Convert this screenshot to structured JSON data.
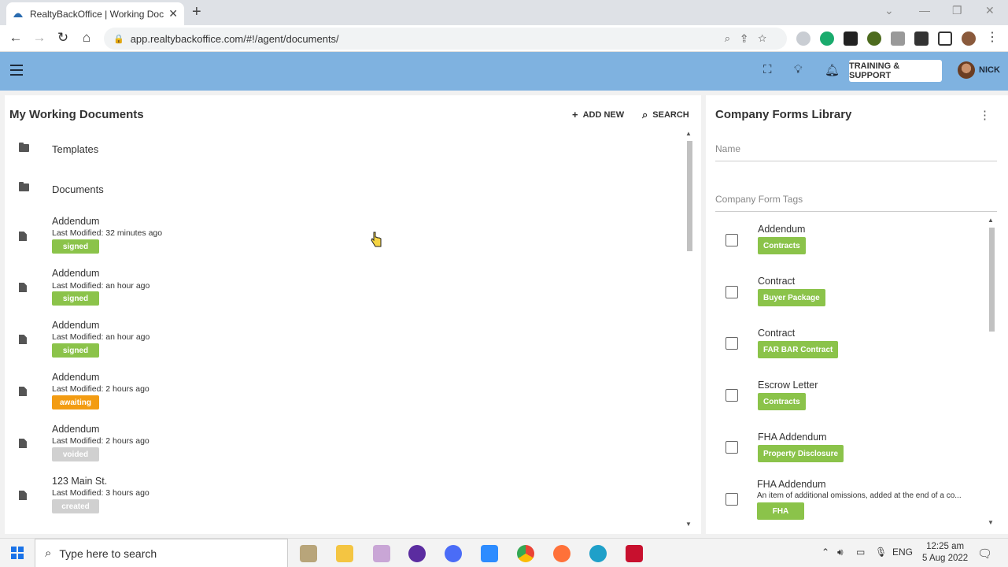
{
  "browser": {
    "tab_title": "RealtyBackOffice | Working Docu",
    "url": "app.realtybackoffice.com/#!/agent/documents/"
  },
  "appbar": {
    "support_label": "TRAINING & SUPPORT",
    "user_name": "NICK"
  },
  "left_panel": {
    "title": "My Working Documents",
    "add_new_label": "ADD NEW",
    "search_label": "SEARCH",
    "folders": [
      {
        "label": "Templates"
      },
      {
        "label": "Documents"
      }
    ],
    "documents": [
      {
        "name": "Addendum",
        "modified": "Last Modified: 32 minutes ago",
        "status": "signed",
        "status_color": "#8bc34a"
      },
      {
        "name": "Addendum",
        "modified": "Last Modified: an hour ago",
        "status": "signed",
        "status_color": "#8bc34a"
      },
      {
        "name": "Addendum",
        "modified": "Last Modified: an hour ago",
        "status": "signed",
        "status_color": "#8bc34a"
      },
      {
        "name": "Addendum",
        "modified": "Last Modified: 2 hours ago",
        "status": "awaiting",
        "status_color": "#f39c12"
      },
      {
        "name": "Addendum",
        "modified": "Last Modified: 2 hours ago",
        "status": "voided",
        "status_color": "#d0d0d0"
      },
      {
        "name": "123 Main St.",
        "modified": "Last Modified: 3 hours ago",
        "status": "created",
        "status_color": "#d0d0d0"
      }
    ]
  },
  "right_panel": {
    "title": "Company Forms Library",
    "name_placeholder": "Name",
    "tags_placeholder": "Company Form Tags",
    "forms": [
      {
        "name": "Addendum",
        "description": "",
        "tag": "Contracts"
      },
      {
        "name": "Contract",
        "description": "",
        "tag": "Buyer Package"
      },
      {
        "name": "Contract",
        "description": "",
        "tag": "FAR BAR Contract"
      },
      {
        "name": "Escrow Letter",
        "description": "",
        "tag": "Contracts"
      },
      {
        "name": "FHA Addendum",
        "description": "",
        "tag": "Property Disclosure"
      },
      {
        "name": "FHA Addendum",
        "description": "An item of additional omissions, added at the end of a co...",
        "tag": "FHA"
      }
    ]
  },
  "taskbar": {
    "search_placeholder": "Type here to search",
    "language": "ENG",
    "time": "12:25 am",
    "date": "5 Aug 2022"
  },
  "colors": {
    "appbar": "#7fb2e0",
    "tag_green": "#8bc34a",
    "awaiting_orange": "#f39c12",
    "inactive_grey": "#d0d0d0"
  }
}
